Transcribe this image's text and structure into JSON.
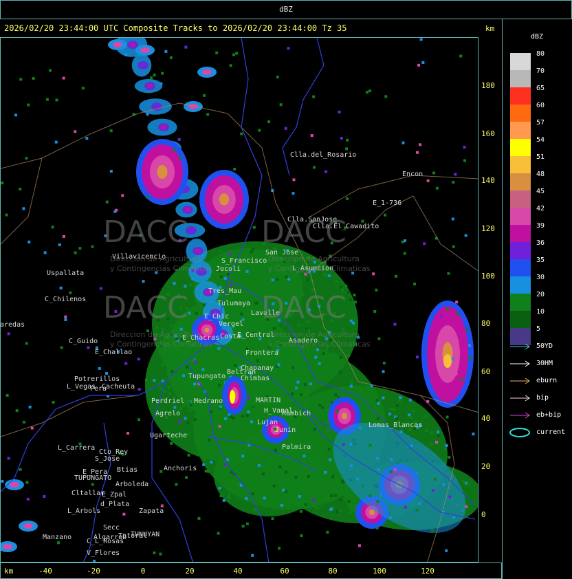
{
  "top_title": "dBZ",
  "header": "2026/02/20 23:44:00 UTC Composite Tracks to 2026/02/20 23:44:00 Tz 35",
  "km_label": "km",
  "x_ticks": [
    "-40",
    "-20",
    "0",
    "20",
    "40",
    "60",
    "80",
    "100",
    "120"
  ],
  "y_ticks": [
    "180",
    "160",
    "140",
    "120",
    "100",
    "80",
    "60",
    "40",
    "20",
    "0"
  ],
  "color_scale": {
    "title": "dBZ",
    "levels": [
      {
        "label": "80",
        "color": "#d8d8d8"
      },
      {
        "label": "70",
        "color": "#b8b8b8"
      },
      {
        "label": "65",
        "color": "#ff3020"
      },
      {
        "label": "60",
        "color": "#ff6a10"
      },
      {
        "label": "57",
        "color": "#ff9a50"
      },
      {
        "label": "54",
        "color": "#ffff00"
      },
      {
        "label": "51",
        "color": "#f8c038"
      },
      {
        "label": "48",
        "color": "#d89040"
      },
      {
        "label": "45",
        "color": "#c86080"
      },
      {
        "label": "42",
        "color": "#d848a8"
      },
      {
        "label": "39",
        "color": "#c010a0"
      },
      {
        "label": "36",
        "color": "#7020d8"
      },
      {
        "label": "35",
        "color": "#2050f0"
      },
      {
        "label": "30",
        "color": "#1890e0"
      },
      {
        "label": "20",
        "color": "#10801a"
      },
      {
        "label": "10",
        "color": "#086010"
      },
      {
        "label": "5",
        "color": "#483888"
      }
    ]
  },
  "legend": [
    {
      "label": "50YD",
      "color": "#40d0d0",
      "type": "arrow"
    },
    {
      "label": "30HM",
      "color": "#ffffff",
      "type": "arrow"
    },
    {
      "label": "eburn",
      "color": "#f0b060",
      "type": "arrow"
    },
    {
      "label": "bip",
      "color": "#ffd0e0",
      "type": "arrow"
    },
    {
      "label": "eb+bip",
      "color": "#e040e0",
      "type": "arrow"
    },
    {
      "label": "current",
      "color": "#30e0e0",
      "type": "ellipse"
    }
  ],
  "places": [
    "Clla.del_Rosario",
    "Encon",
    "E_1-736",
    "Clla.SanJose",
    "Clla.El_Cawadito",
    "San Jose",
    "L_Asuncion",
    "S_Francisco",
    "Jocoli",
    "Villavicencio",
    "Uspallata",
    "C_Chilenos",
    "Tres_Mau",
    "Tulumaya",
    "E_Chic",
    "Vergel",
    "E_Central",
    "Lavalle",
    "Costa",
    "E_Chacras",
    "Asadero",
    "Frontera",
    "C_Guido",
    "E_Challao",
    "Chapanay",
    "Potrerillos",
    "L_Vegas",
    "Cacheuta",
    "Perdriel",
    "Agrelo",
    "MARTIN",
    "H_Vanal",
    "Rambich",
    "Ugarteche",
    "Lomas_Blancas",
    "L_Carrera",
    "Cto_Rey",
    "S_Jose",
    "E_Pera",
    "Btias",
    "TUPUNGATO",
    "Anchoris",
    "Arboleda",
    "Cltallar",
    "E_Zpal",
    "L_Arbols",
    "d_Plata",
    "Zapata",
    "Algarrob",
    "Secc",
    "Manzano",
    "Totoral",
    "TUNUYAN",
    "C_L_Rosas",
    "V_Flores",
    "aredas",
    "Pera",
    "Tupungato",
    "Medrano",
    "Chimbas",
    "Beltran",
    "Palmira",
    "Lujan",
    "Junin"
  ],
  "watermark": {
    "brand": "DACC",
    "line1": "Direccion de Agricultura",
    "line2": "y Contingencias Climaticas"
  }
}
